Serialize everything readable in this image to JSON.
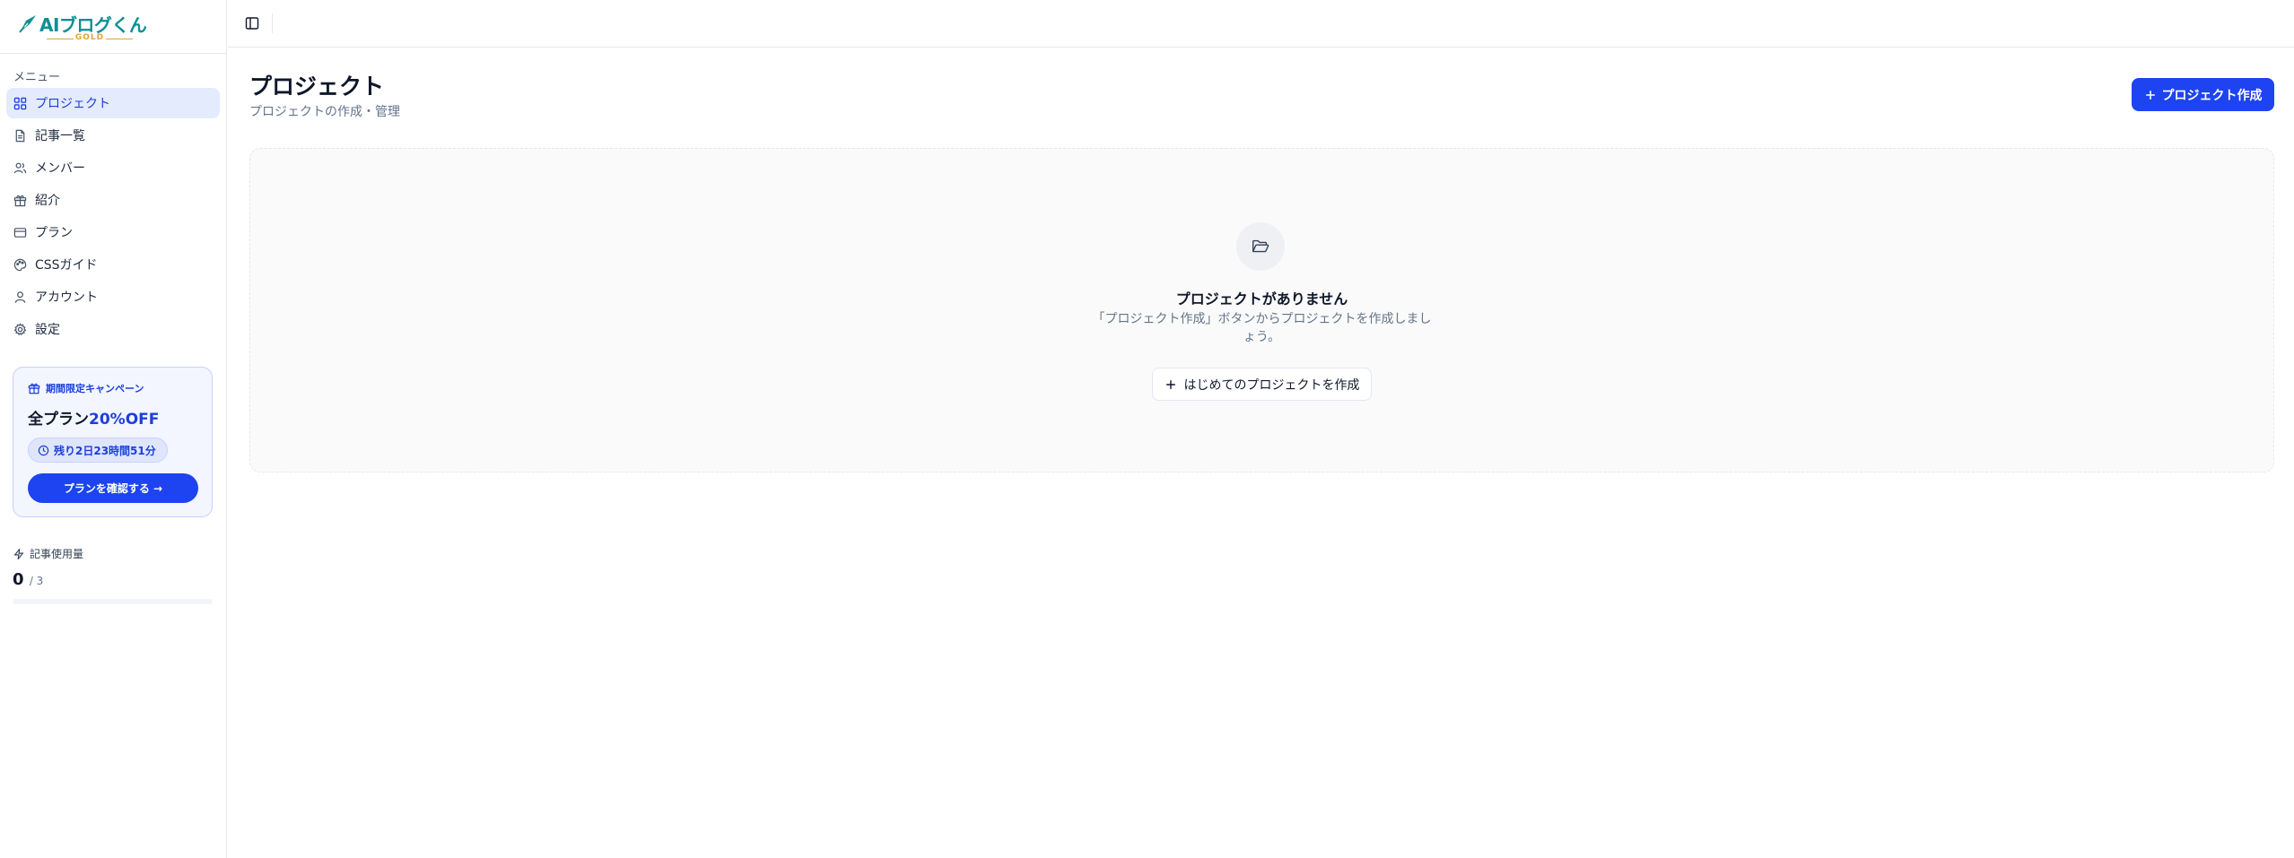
{
  "brand": {
    "name": "AIブログくん",
    "tier": "GOLD",
    "accent_color": "#0e8f95",
    "tier_color": "#e0a33a"
  },
  "sidebar": {
    "menu_heading": "メニュー",
    "items": [
      {
        "label": "プロジェクト",
        "icon": "grid-icon",
        "active": true
      },
      {
        "label": "記事一覧",
        "icon": "document-icon"
      },
      {
        "label": "メンバー",
        "icon": "users-icon"
      },
      {
        "label": "紹介",
        "icon": "gift-icon"
      },
      {
        "label": "プラン",
        "icon": "credit-card-icon"
      },
      {
        "label": "CSSガイド",
        "icon": "palette-icon"
      },
      {
        "label": "アカウント",
        "icon": "user-icon"
      },
      {
        "label": "設定",
        "icon": "gear-icon"
      }
    ],
    "promo": {
      "title": "期間限定キャンペーン",
      "headline": "全プラン",
      "headline_accent": "20%OFF",
      "timer": "残り2日23時間51分",
      "button_label": "プランを確認する →"
    },
    "usage": {
      "label": "記事使用量",
      "used": "0",
      "total": "/ 3",
      "fraction": 0
    }
  },
  "main": {
    "title": "プロジェクト",
    "subtitle": "プロジェクトの作成・管理",
    "create_button": "プロジェクト作成",
    "empty": {
      "title": "プロジェクトがありません",
      "description": "「プロジェクト作成」ボタンからプロジェクトを作成しましょう。",
      "button": "はじめてのプロジェクトを作成"
    }
  },
  "colors": {
    "primary": "#1d44f0",
    "active_bg": "#e3ebfd"
  }
}
